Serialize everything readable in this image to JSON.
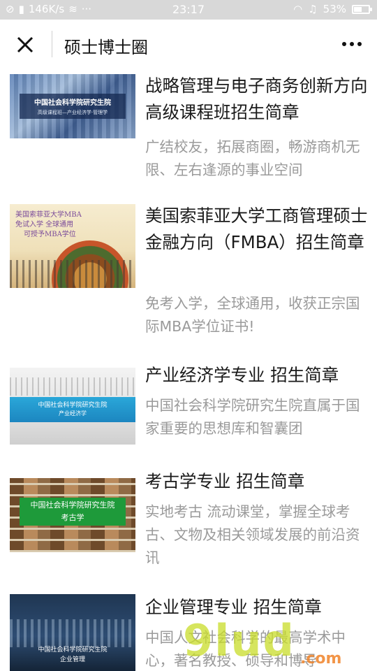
{
  "status_bar": {
    "network_speed": "146K/s",
    "time": "23:17",
    "battery": "53%"
  },
  "header": {
    "title": "硕士博士圈"
  },
  "articles": [
    {
      "title": "战略管理与电子商务创新方向高级课程班招生简章",
      "desc": "广结校友，拓展商圈，畅游商机无限、左右逢源的事业空间",
      "thumb_line1": "中国社会科学院研究生院",
      "thumb_line2": "高级课程班—产业经济学·管理学"
    },
    {
      "title": "美国索菲亚大学工商管理硕士金融方向（FMBA）招生简章",
      "desc": "免考入学，全球通用，收获正宗国际MBA学位证书!",
      "thumb_line1": "美国索菲亚大学MBA",
      "thumb_line2": "免试入学  全球通用",
      "thumb_line3": "可授予MBA学位"
    },
    {
      "title": "产业经济学专业 招生简章",
      "desc": "中国社会科学院研究生院直属于国家重要的思想库和智囊团",
      "thumb_line1": "中国社会科学院研究生院",
      "thumb_line2": "产业经济学"
    },
    {
      "title": "考古学专业 招生简章",
      "desc": "实地考古 流动课堂，掌握全球考古、文物及相关领域发展的前沿资讯",
      "thumb_line1": "中国社会科学院研究生院",
      "thumb_line2": "考古学"
    },
    {
      "title": "企业管理专业 招生简章",
      "desc": "中国人文社会科学的最高学术中心，著名教授、硕导和博导",
      "thumb_line1": "中国社会科学院研究生院",
      "thumb_line2": "企业管理"
    }
  ],
  "watermark": {
    "text": "9lud",
    "sub": ".com"
  }
}
